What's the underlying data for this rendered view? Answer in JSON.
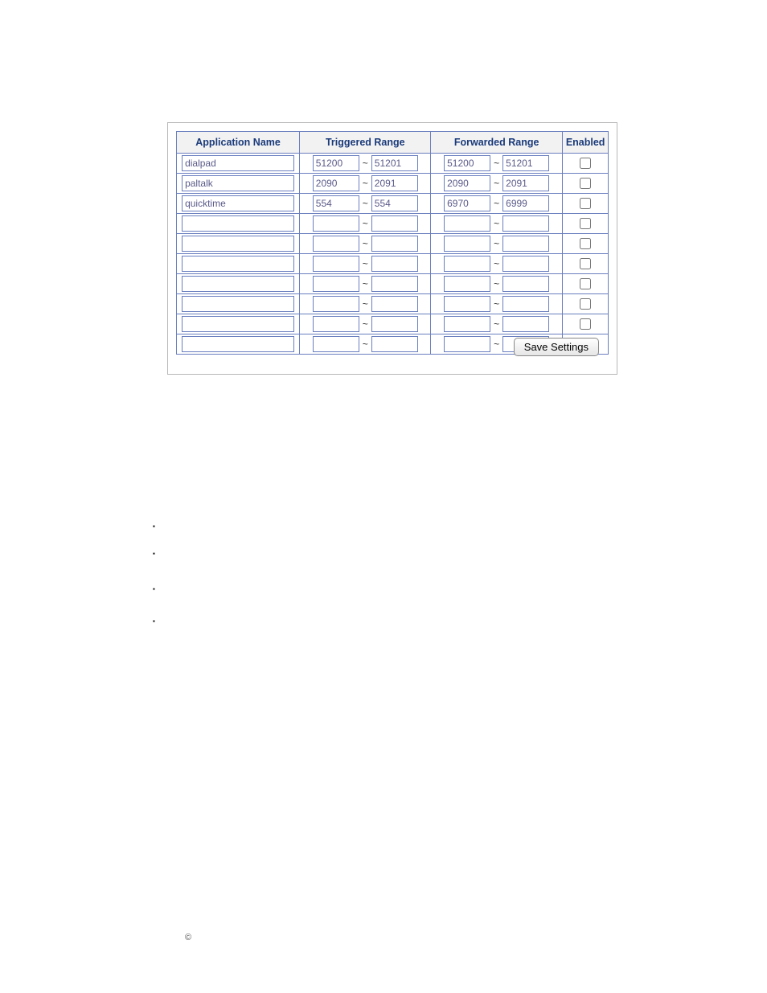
{
  "headers": {
    "app": "Application Name",
    "triggered": "Triggered Range",
    "forwarded": "Forwarded Range",
    "enabled": "Enabled"
  },
  "rows": [
    {
      "app": "dialpad",
      "tr_start": "51200",
      "tr_end": "51201",
      "fw_start": "51200",
      "fw_end": "51201",
      "enabled": false
    },
    {
      "app": "paltalk",
      "tr_start": "2090",
      "tr_end": "2091",
      "fw_start": "2090",
      "fw_end": "2091",
      "enabled": false
    },
    {
      "app": "quicktime",
      "tr_start": "554",
      "tr_end": "554",
      "fw_start": "6970",
      "fw_end": "6999",
      "enabled": false
    },
    {
      "app": "",
      "tr_start": "",
      "tr_end": "",
      "fw_start": "",
      "fw_end": "",
      "enabled": false
    },
    {
      "app": "",
      "tr_start": "",
      "tr_end": "",
      "fw_start": "",
      "fw_end": "",
      "enabled": false
    },
    {
      "app": "",
      "tr_start": "",
      "tr_end": "",
      "fw_start": "",
      "fw_end": "",
      "enabled": false
    },
    {
      "app": "",
      "tr_start": "",
      "tr_end": "",
      "fw_start": "",
      "fw_end": "",
      "enabled": false
    },
    {
      "app": "",
      "tr_start": "",
      "tr_end": "",
      "fw_start": "",
      "fw_end": "",
      "enabled": false
    },
    {
      "app": "",
      "tr_start": "",
      "tr_end": "",
      "fw_start": "",
      "fw_end": "",
      "enabled": false
    },
    {
      "app": "",
      "tr_start": "",
      "tr_end": "",
      "fw_start": "",
      "fw_end": "",
      "enabled": false
    }
  ],
  "tilde": "~",
  "save_label": "Save Settings",
  "bullets": [
    "",
    "",
    "",
    ""
  ],
  "copyright": "©"
}
